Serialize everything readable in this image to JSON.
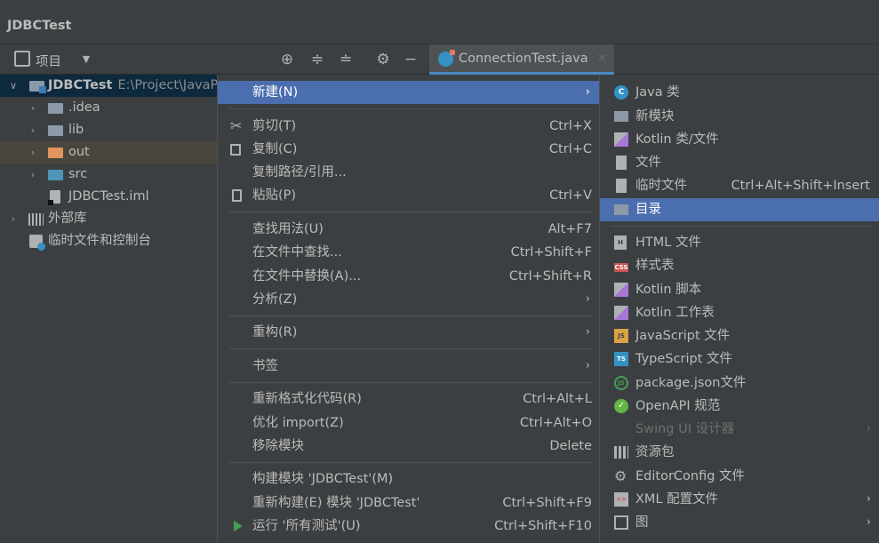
{
  "window": {
    "project_title": "JDBCTest"
  },
  "toolbar": {
    "project_view_label": "项目",
    "tab": {
      "name": "ConnectionTest.java",
      "close": "×"
    }
  },
  "tree": {
    "root": {
      "label": "JDBCTest",
      "path": "E:\\Project\\JavaP"
    },
    "items": [
      {
        "label": ".idea"
      },
      {
        "label": "lib"
      },
      {
        "label": "out"
      },
      {
        "label": "src"
      },
      {
        "label": "JDBCTest.iml"
      },
      {
        "label": "外部库"
      },
      {
        "label": "临时文件和控制台"
      }
    ]
  },
  "context_menu": {
    "items": [
      {
        "label": "新建(N)"
      },
      {
        "label": "剪切(T)",
        "shortcut": "Ctrl+X"
      },
      {
        "label": "复制(C)",
        "shortcut": "Ctrl+C"
      },
      {
        "label": "复制路径/引用..."
      },
      {
        "label": "粘贴(P)",
        "shortcut": "Ctrl+V"
      },
      {
        "label": "查找用法(U)",
        "shortcut": "Alt+F7"
      },
      {
        "label": "在文件中查找...",
        "shortcut": "Ctrl+Shift+F"
      },
      {
        "label": "在文件中替换(A)...",
        "shortcut": "Ctrl+Shift+R"
      },
      {
        "label": "分析(Z)"
      },
      {
        "label": "重构(R)"
      },
      {
        "label": "书签"
      },
      {
        "label": "重新格式化代码(R)",
        "shortcut": "Ctrl+Alt+L"
      },
      {
        "label": "优化 import(Z)",
        "shortcut": "Ctrl+Alt+O"
      },
      {
        "label": "移除模块",
        "shortcut": "Delete"
      },
      {
        "label": "构建模块 'JDBCTest'(M)"
      },
      {
        "label": "重新构建(E) 模块 'JDBCTest'",
        "shortcut": "Ctrl+Shift+F9"
      },
      {
        "label": "运行 '所有测试'(U)",
        "shortcut": "Ctrl+Shift+F10"
      }
    ]
  },
  "new_submenu": {
    "items": [
      {
        "label": "Java 类"
      },
      {
        "label": "新模块"
      },
      {
        "label": "Kotlin 类/文件"
      },
      {
        "label": "文件"
      },
      {
        "label": "临时文件",
        "shortcut": "Ctrl+Alt+Shift+Insert"
      },
      {
        "label": "目录"
      },
      {
        "label": "HTML 文件"
      },
      {
        "label": "样式表"
      },
      {
        "label": "Kotlin 脚本"
      },
      {
        "label": "Kotlin 工作表"
      },
      {
        "label": "JavaScript 文件"
      },
      {
        "label": "TypeScript 文件"
      },
      {
        "label": "package.json文件"
      },
      {
        "label": "OpenAPI 规范"
      },
      {
        "label": "Swing UI 设计器"
      },
      {
        "label": "资源包"
      },
      {
        "label": "EditorConfig 文件"
      },
      {
        "label": "XML 配置文件"
      },
      {
        "label": "图"
      }
    ]
  },
  "colors": {
    "highlight": "#4b6eaf",
    "panel": "#3c3f41",
    "selection": "#0d293e"
  }
}
